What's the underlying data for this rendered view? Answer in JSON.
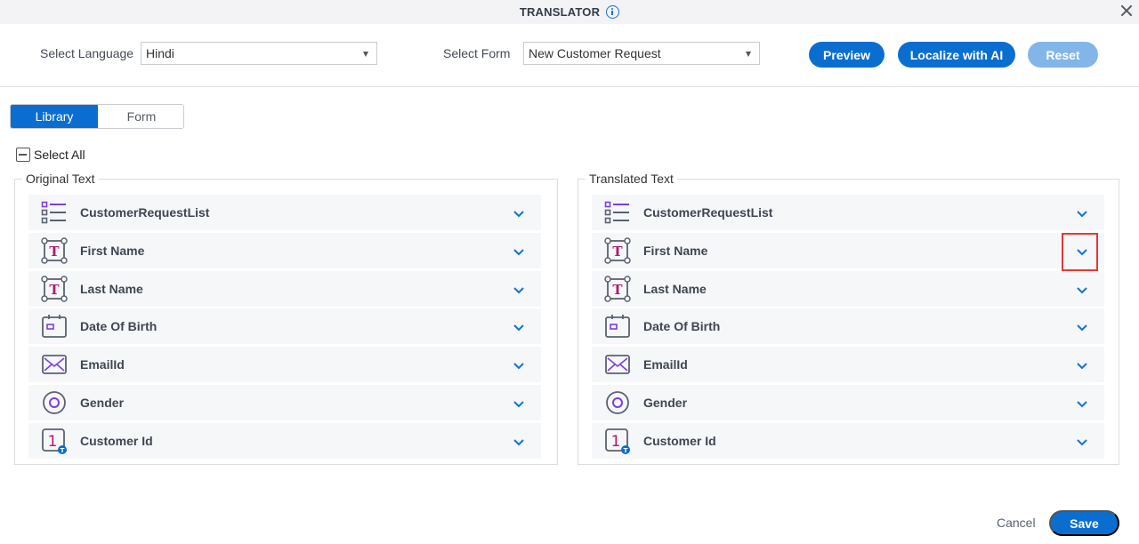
{
  "window": {
    "title": "TRANSLATOR",
    "info_icon": "info-icon",
    "close_icon": "close-icon"
  },
  "toolbar": {
    "language_label": "Select Language",
    "language_value": "Hindi",
    "form_label": "Select Form",
    "form_value": "New Customer Request",
    "preview_label": "Preview",
    "localize_label": "Localize with AI",
    "reset_label": "Reset",
    "reset_disabled": true
  },
  "tabs": [
    {
      "label": "Library",
      "active": true
    },
    {
      "label": "Form",
      "active": false
    }
  ],
  "select_all_label": "Select All",
  "original_panel": {
    "legend": "Original Text",
    "items": [
      {
        "label": "CustomerRequestList",
        "icon": "list-icon"
      },
      {
        "label": "First Name",
        "icon": "text-field-icon"
      },
      {
        "label": "Last Name",
        "icon": "text-field-icon"
      },
      {
        "label": "Date Of Birth",
        "icon": "calendar-icon"
      },
      {
        "label": "EmailId",
        "icon": "email-icon"
      },
      {
        "label": "Gender",
        "icon": "radio-icon"
      },
      {
        "label": "Customer Id",
        "icon": "number-icon"
      }
    ]
  },
  "translated_panel": {
    "legend": "Translated Text",
    "items": [
      {
        "label": "CustomerRequestList",
        "icon": "list-icon"
      },
      {
        "label": "First Name",
        "icon": "text-field-icon",
        "highlighted": true
      },
      {
        "label": "Last Name",
        "icon": "text-field-icon"
      },
      {
        "label": "Date Of Birth",
        "icon": "calendar-icon"
      },
      {
        "label": "EmailId",
        "icon": "email-icon"
      },
      {
        "label": "Gender",
        "icon": "radio-icon"
      },
      {
        "label": "Customer Id",
        "icon": "number-icon"
      }
    ]
  },
  "footer": {
    "cancel_label": "Cancel",
    "save_label": "Save"
  },
  "colors": {
    "primary": "#0a6ed1",
    "primary_disabled": "#82b6e8",
    "icon_purple": "#7b3fe4",
    "icon_magenta": "#b0186e",
    "highlight": "#e53935"
  }
}
